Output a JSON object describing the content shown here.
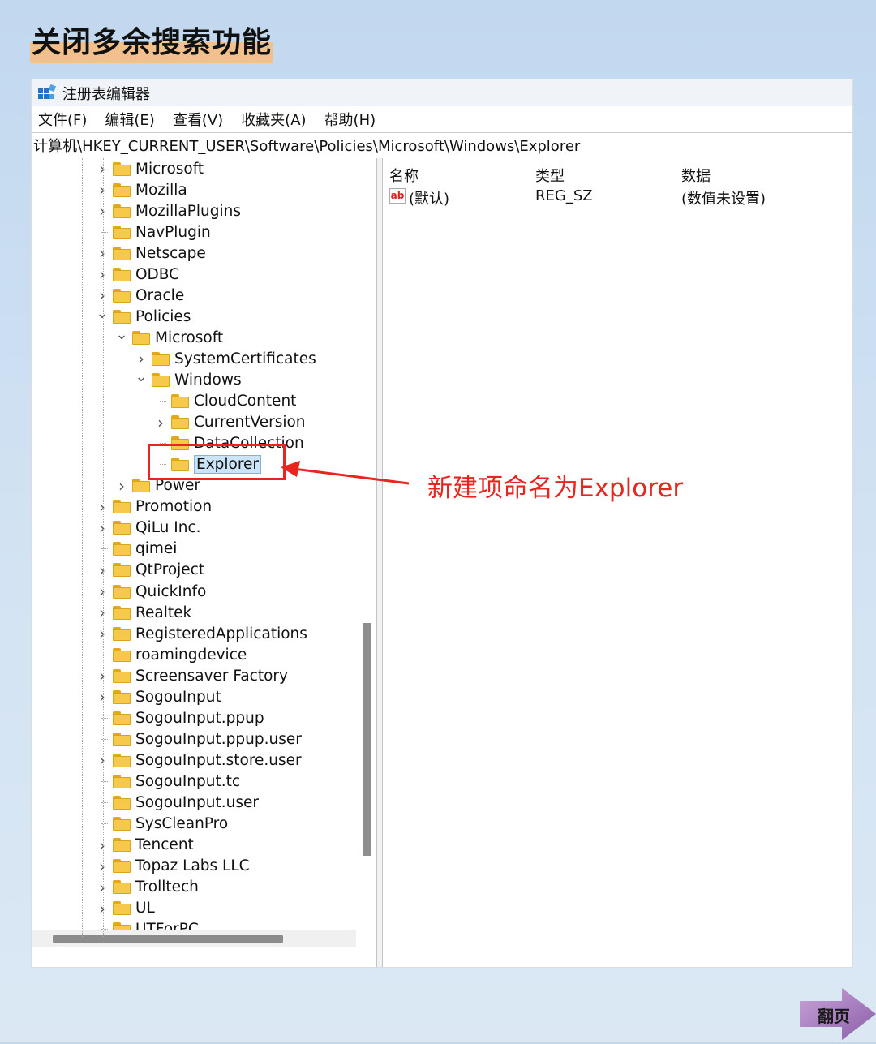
{
  "banner": {
    "title": "关闭多余搜索功能"
  },
  "window": {
    "title": "注册表编辑器"
  },
  "menu": [
    {
      "label": "文件(F)"
    },
    {
      "label": "编辑(E)"
    },
    {
      "label": "查看(V)"
    },
    {
      "label": "收藏夹(A)"
    },
    {
      "label": "帮助(H)"
    }
  ],
  "address": "计算机\\HKEY_CURRENT_USER\\Software\\Policies\\Microsoft\\Windows\\Explorer",
  "tree": [
    {
      "label": "Microsoft",
      "level": 0,
      "expander": "collapsed"
    },
    {
      "label": "Mozilla",
      "level": 0,
      "expander": "collapsed"
    },
    {
      "label": "MozillaPlugins",
      "level": 0,
      "expander": "collapsed"
    },
    {
      "label": "NavPlugin",
      "level": 0,
      "expander": "none"
    },
    {
      "label": "Netscape",
      "level": 0,
      "expander": "collapsed"
    },
    {
      "label": "ODBC",
      "level": 0,
      "expander": "collapsed"
    },
    {
      "label": "Oracle",
      "level": 0,
      "expander": "collapsed"
    },
    {
      "label": "Policies",
      "level": 0,
      "expander": "expanded"
    },
    {
      "label": "Microsoft",
      "level": 1,
      "expander": "expanded"
    },
    {
      "label": "SystemCertificates",
      "level": 2,
      "expander": "collapsed"
    },
    {
      "label": "Windows",
      "level": 2,
      "expander": "expanded"
    },
    {
      "label": "CloudContent",
      "level": 3,
      "expander": "none"
    },
    {
      "label": "CurrentVersion",
      "level": 3,
      "expander": "collapsed"
    },
    {
      "label": "DataCollection",
      "level": 3,
      "expander": "none"
    },
    {
      "label": "Explorer",
      "level": 3,
      "expander": "none",
      "selected": true
    },
    {
      "label": "Power",
      "level": 1,
      "expander": "collapsed"
    },
    {
      "label": "Promotion",
      "level": 0,
      "expander": "collapsed"
    },
    {
      "label": "QiLu Inc.",
      "level": 0,
      "expander": "collapsed"
    },
    {
      "label": "qimei",
      "level": 0,
      "expander": "none"
    },
    {
      "label": "QtProject",
      "level": 0,
      "expander": "collapsed"
    },
    {
      "label": "QuickInfo",
      "level": 0,
      "expander": "collapsed"
    },
    {
      "label": "Realtek",
      "level": 0,
      "expander": "collapsed"
    },
    {
      "label": "RegisteredApplications",
      "level": 0,
      "expander": "collapsed"
    },
    {
      "label": "roamingdevice",
      "level": 0,
      "expander": "none"
    },
    {
      "label": "Screensaver Factory",
      "level": 0,
      "expander": "collapsed"
    },
    {
      "label": "SogouInput",
      "level": 0,
      "expander": "collapsed"
    },
    {
      "label": "SogouInput.ppup",
      "level": 0,
      "expander": "none"
    },
    {
      "label": "SogouInput.ppup.user",
      "level": 0,
      "expander": "none"
    },
    {
      "label": "SogouInput.store.user",
      "level": 0,
      "expander": "collapsed"
    },
    {
      "label": "SogouInput.tc",
      "level": 0,
      "expander": "none"
    },
    {
      "label": "SogouInput.user",
      "level": 0,
      "expander": "none"
    },
    {
      "label": "SysCleanPro",
      "level": 0,
      "expander": "none"
    },
    {
      "label": "Tencent",
      "level": 0,
      "expander": "collapsed"
    },
    {
      "label": "Topaz Labs LLC",
      "level": 0,
      "expander": "collapsed"
    },
    {
      "label": "Trolltech",
      "level": 0,
      "expander": "collapsed"
    },
    {
      "label": "UL",
      "level": 0,
      "expander": "collapsed"
    },
    {
      "label": "UTForPC",
      "level": 0,
      "expander": "none"
    }
  ],
  "list": {
    "headers": {
      "name": "名称",
      "type": "类型",
      "data": "数据"
    },
    "rows": [
      {
        "icon": "ab",
        "name": "(默认)",
        "type": "REG_SZ",
        "data": "(数值未设置)"
      }
    ]
  },
  "annotation": {
    "text": "新建项命名为Explorer",
    "color": "#e8261f"
  },
  "next_button": {
    "label": "翻页"
  }
}
